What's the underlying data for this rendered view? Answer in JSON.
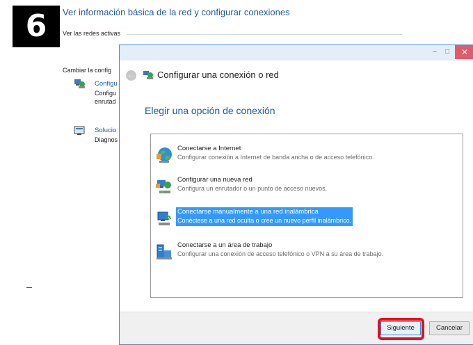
{
  "step_number": "6",
  "background": {
    "title": "Ver información básica de la red y configurar conexiones",
    "active_networks": "Ver las redes activas",
    "change_settings": "Cambiar la config",
    "items": [
      {
        "link": "Configu",
        "desc_line1": "Configu",
        "desc_line2": "enrutad",
        "icon": "network-setup-icon"
      },
      {
        "link": "Solucio",
        "desc_line1": "Diagnos",
        "icon": "troubleshoot-icon"
      }
    ]
  },
  "dialog": {
    "window_controls": {
      "minimize": "–",
      "maximize": "□",
      "close": "✕"
    },
    "title": "Configurar una conexión o red",
    "heading": "Elegir una opción de conexión",
    "options": [
      {
        "title": "Conectarse a Internet",
        "desc": "Configurar conexión a Internet de banda ancha o de acceso telefónico.",
        "icon": "internet-globe-icon",
        "selected": false
      },
      {
        "title": "Configurar una nueva red",
        "desc": "Configura un enrutador o un punto de acceso nuevos.",
        "icon": "new-network-router-icon",
        "selected": false
      },
      {
        "title": "Conectarse manualmente a una red inalámbrica",
        "desc": "Conéctese a una red oculta o cree un nuevo perfil inalámbrico.",
        "icon": "wireless-network-icon",
        "selected": true
      },
      {
        "title": "Conectarse a un área de trabajo",
        "desc": "Configurar una conexión de acceso telefónico o VPN a su área de trabajo.",
        "icon": "workplace-vpn-icon",
        "selected": false
      }
    ],
    "buttons": {
      "next": "Siguiente",
      "cancel": "Cancelar"
    }
  },
  "colors": {
    "link_blue": "#1e5aa8",
    "selection": "#3399ff",
    "highlight_red": "#e01020",
    "close_red": "#e35a6b"
  }
}
